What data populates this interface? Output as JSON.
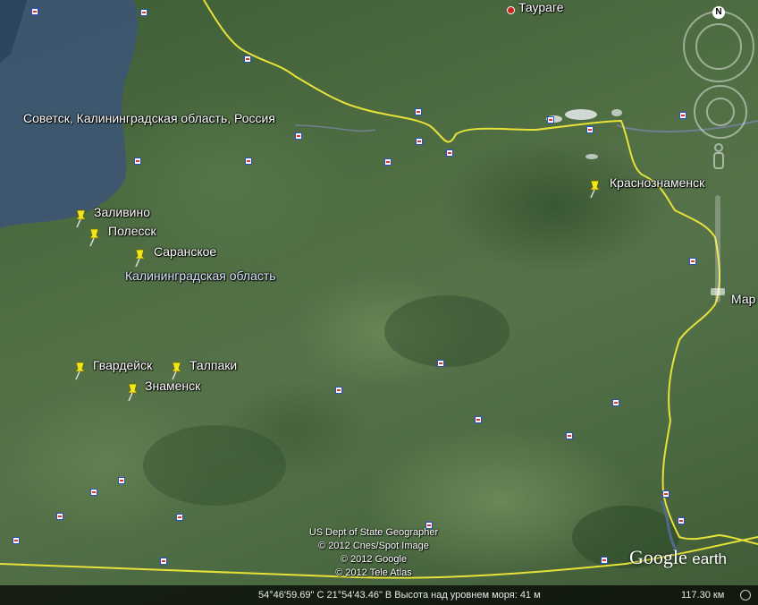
{
  "map": {
    "cities": [
      {
        "name": "Советск, Калининградская область, Россия"
      },
      {
        "name": "Таураге"
      },
      {
        "name": "Мар"
      }
    ],
    "region": "Калининградская область",
    "placemarks": [
      {
        "name": "Заливино"
      },
      {
        "name": "Полесск"
      },
      {
        "name": "Саранское"
      },
      {
        "name": "Краснознаменск"
      },
      {
        "name": "Гвардейск"
      },
      {
        "name": "Талпаки"
      },
      {
        "name": "Знаменск"
      }
    ],
    "attribution": [
      "US Dept of State Geographer",
      "© 2012 Cnes/Spot Image",
      "© 2012 Google",
      "© 2012 Tele Atlas"
    ],
    "logo": {
      "brand": "Google",
      "product": "earth"
    },
    "status": {
      "coords": "54°46'59.69\" С   21°54'43.46\" В  Высота над уровнем моря: 41 м",
      "altitude": "117.30 км"
    },
    "nav": {
      "north_label": "N"
    },
    "colors": {
      "border": "#e6e23a",
      "pin": "#f2e61c",
      "water": "#3b5573"
    }
  }
}
